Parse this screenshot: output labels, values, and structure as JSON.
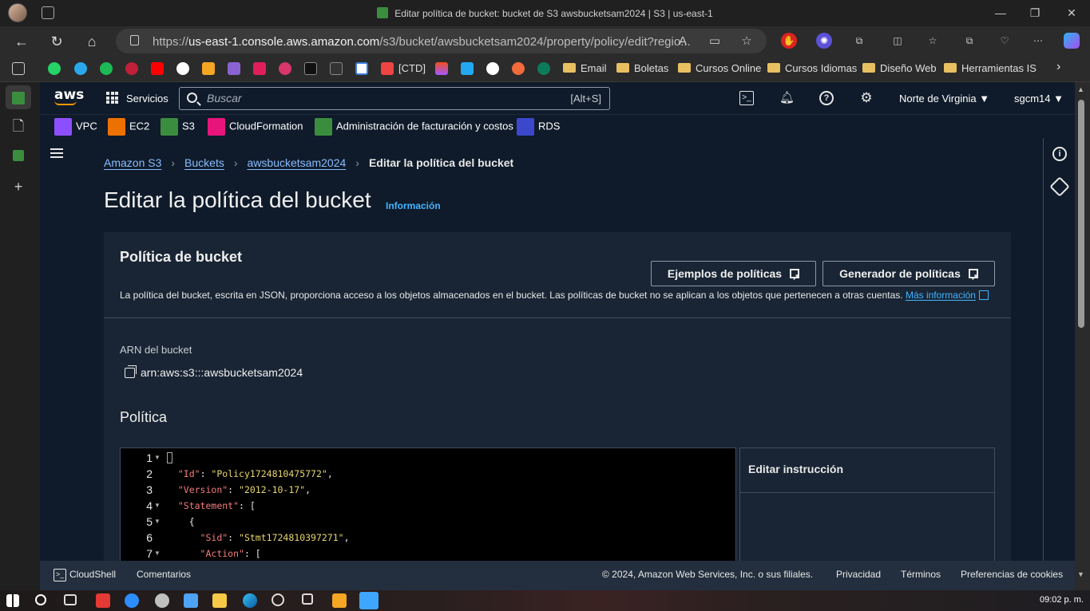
{
  "browser": {
    "window_title": "Editar política de bucket: bucket de S3 awsbucketsam2024 | S3 | us-east-1",
    "url_prefix": "https://",
    "url_host": "us-east-1.console.aws.amazon.com",
    "url_path": "/s3/bucket/awsbucketsam2024/property/policy/edit?regio..."
  },
  "bookmarks": {
    "ctd": "[CTD]",
    "folders": [
      "Email",
      "Boletas",
      "Cursos Online",
      "Cursos Idiomas",
      "Diseño Web",
      "Herramientas IS"
    ]
  },
  "aws_nav": {
    "logo": "aws",
    "services": "Servicios",
    "search_placeholder": "Buscar",
    "search_shortcut": "[Alt+S]",
    "region": "Norte de Virginia ▼",
    "user": "sgcm14 ▼"
  },
  "favorites": [
    "VPC",
    "EC2",
    "S3",
    "CloudFormation",
    "Administración de facturación y costos",
    "RDS"
  ],
  "breadcrumb": {
    "s3": "Amazon S3",
    "buckets": "Buckets",
    "bucket": "awsbucketsam2024",
    "current": "Editar la política del bucket"
  },
  "page": {
    "title": "Editar la política del bucket",
    "info": "Información"
  },
  "panel": {
    "title": "Política de bucket",
    "examples_button": "Ejemplos de políticas",
    "generator_button": "Generador de políticas",
    "description": "La política del bucket, escrita en JSON, proporciona acceso a los objetos almacenados en el bucket. Las políticas de bucket no se aplican a los objetos que pertenecen a otras cuentas.",
    "more_info": "Más información",
    "arn_label": "ARN del bucket",
    "arn_value": "arn:aws:s3:::awsbucketsam2024",
    "policy_label": "Política",
    "edit_statement": "Editar instrucción"
  },
  "editor": {
    "line_numbers": [
      "1",
      "2",
      "3",
      "4",
      "5",
      "6",
      "7"
    ],
    "lines": [
      "{",
      "  \"Id\": \"Policy1724810475772\",",
      "  \"Version\": \"2012-10-17\",",
      "  \"Statement\": [",
      "    {",
      "      \"Sid\": \"Stmt1724810397271\",",
      "      \"Action\": ["
    ]
  },
  "footer": {
    "cloudshell": "CloudShell",
    "comments": "Comentarios",
    "copyright": "© 2024, Amazon Web Services, Inc. o sus filiales.",
    "privacy": "Privacidad",
    "terms": "Términos",
    "cookies": "Preferencias de cookies"
  },
  "taskbar": {
    "clock": "09:02 p. m."
  },
  "colors": {
    "aws_nav_bg": "#0f1b2a",
    "link": "#89bdff",
    "accent": "#ff9900"
  }
}
